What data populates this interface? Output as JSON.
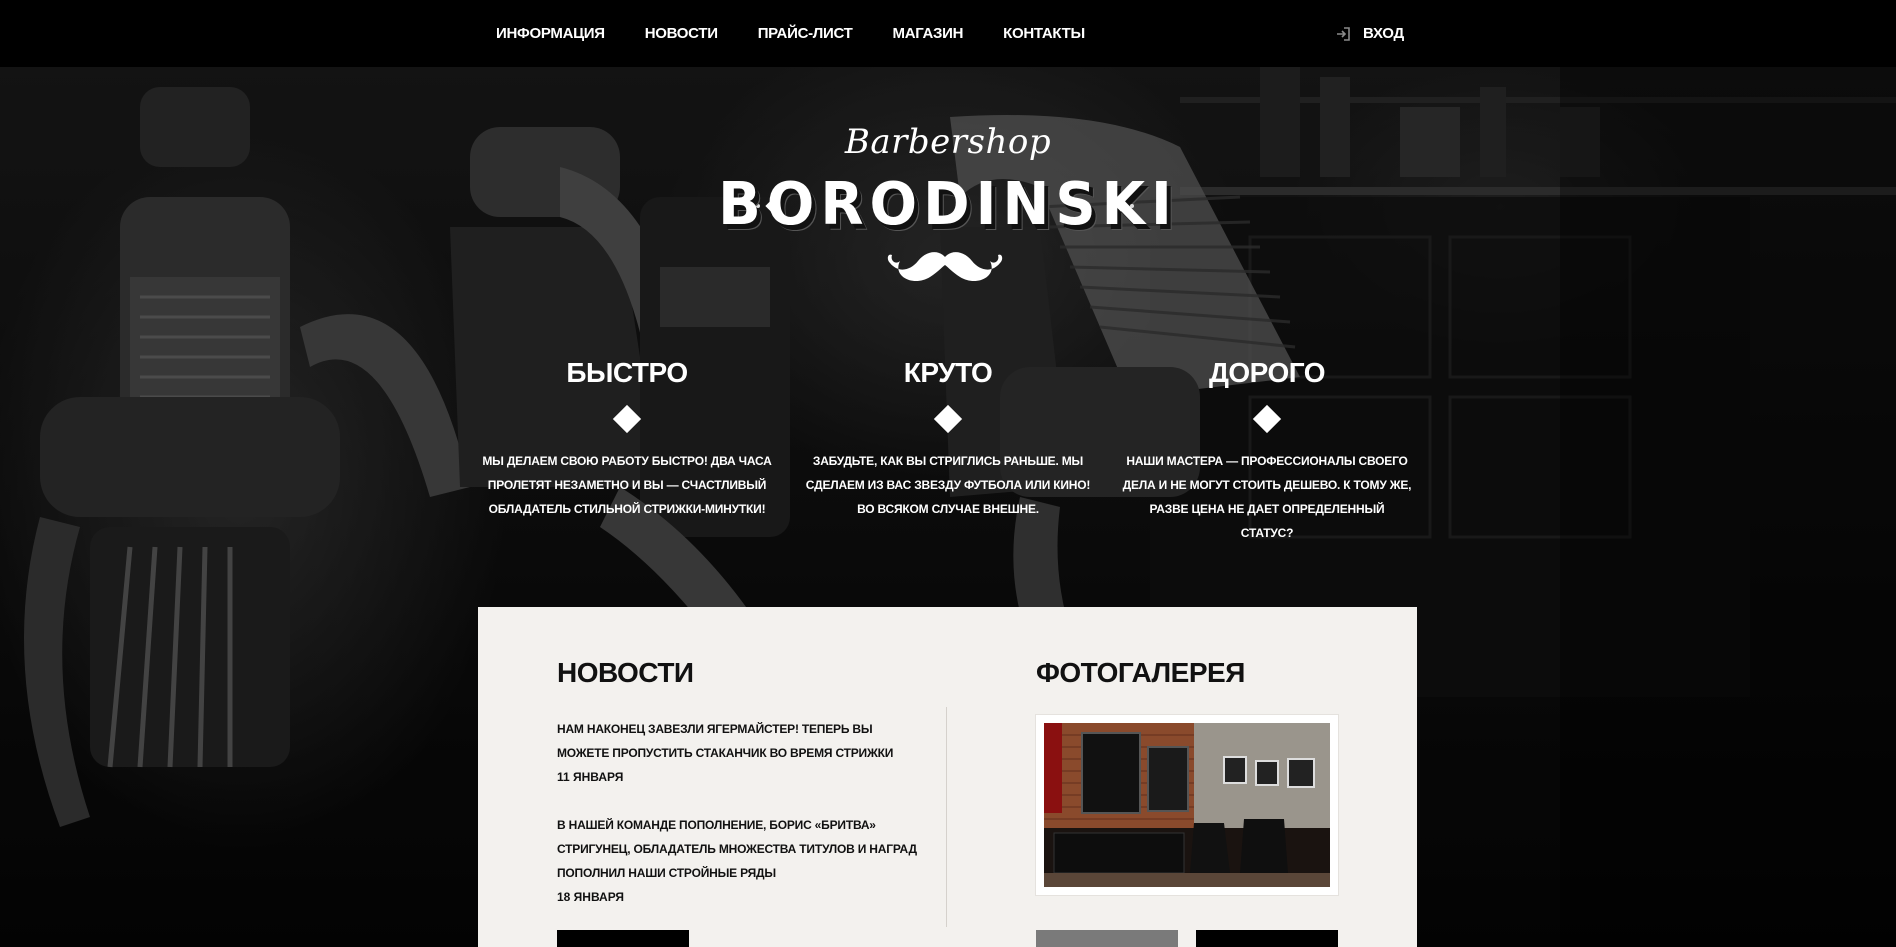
{
  "nav": {
    "items": [
      {
        "label": "ИНФОРМАЦИЯ"
      },
      {
        "label": "НОВОСТИ"
      },
      {
        "label": "ПРАЙС-ЛИСТ"
      },
      {
        "label": "МАГАЗИН"
      },
      {
        "label": "КОНТАКТЫ"
      }
    ],
    "login_label": "ВХОД",
    "login_icon": "sign-in-icon"
  },
  "logo": {
    "script": "Barbershop",
    "name": "BORODINSKI",
    "icon": "mustache-icon"
  },
  "features": [
    {
      "title": "БЫСТРО",
      "text": "МЫ ДЕЛАЕМ СВОЮ РАБОТУ БЫСТРО! ДВА ЧАСА ПРОЛЕТЯТ НЕЗАМЕТНО И ВЫ — СЧАСТЛИВЫЙ ОБЛАДАТЕЛЬ СТИЛЬНОЙ СТРИЖКИ-МИНУТКИ!"
    },
    {
      "title": "КРУТО",
      "text": "ЗАБУДЬТЕ, КАК ВЫ СТРИГЛИСЬ РАНЬШЕ. МЫ СДЕЛАЕМ ИЗ ВАС ЗВЕЗДУ ФУТБОЛА ИЛИ КИНО! ВО ВСЯКОМ СЛУЧАЕ ВНЕШНЕ."
    },
    {
      "title": "ДОРОГО",
      "text": "НАШИ МАСТЕРА — ПРОФЕССИОНАЛЫ СВОЕГО ДЕЛА И НЕ МОГУТ СТОИТЬ ДЕШЕВО. К ТОМУ ЖЕ, РАЗВЕ ЦЕНА НЕ ДАЕТ ОПРЕДЕЛЕННЫЙ СТАТУС?"
    }
  ],
  "news": {
    "title": "НОВОСТИ",
    "items": [
      {
        "text": "НАМ НАКОНЕЦ ЗАВЕЗЛИ ЯГЕРМАЙСТЕР! ТЕПЕРЬ ВЫ МОЖЕТЕ ПРОПУСТИТЬ СТАКАНЧИК ВО ВРЕМЯ СТРИЖКИ",
        "date": "11 ЯНВАРЯ"
      },
      {
        "text": "В НАШЕЙ КОМАНДЕ ПОПОЛНЕНИЕ, БОРИС «БРИТВА» СТРИГУНЕЦ, ОБЛАДАТЕЛЬ МНОЖЕСТВА ТИТУЛОВ И НАГРАД ПОПОЛНИЛ НАШИ СТРОЙНЫЕ РЯДЫ",
        "date": "18 ЯНВАРЯ"
      }
    ]
  },
  "gallery": {
    "title": "ФОТОГАЛЕРЕЯ"
  },
  "colors": {
    "topbar": "#000000",
    "card": "#f3f1ee",
    "text_dark": "#111111",
    "text_light": "#ffffff"
  }
}
